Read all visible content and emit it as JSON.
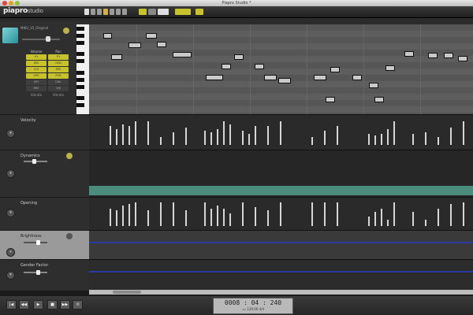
{
  "window": {
    "title": "Piapro Studio *"
  },
  "toolbar": {
    "brand": "piapro",
    "brand_suffix": "studio",
    "accent": "#c7c22c"
  },
  "track": {
    "name": "MIKU_V3_Original",
    "icon": "avatar-icon"
  },
  "vp_grid": {
    "headers": [
      "Volume",
      "Pan"
    ],
    "rows": [
      [
        {
          "label": "V1",
          "on": true
        },
        {
          "label": "P1",
          "on": true
        }
      ],
      [
        {
          "label": "BRI",
          "on": true
        },
        {
          "label": "GEN",
          "on": true
        }
      ],
      [
        {
          "label": "CLE",
          "on": true
        },
        {
          "label": "BRI",
          "on": true
        }
      ],
      [
        {
          "label": "OPE",
          "on": true
        },
        {
          "label": "POR",
          "on": true
        }
      ],
      [
        {
          "label": "XSY",
          "on": false
        },
        {
          "label": "GWL",
          "on": false
        }
      ],
      [
        {
          "label": "BRE",
          "on": false
        },
        {
          "label": "VIB",
          "on": false
        }
      ]
    ],
    "footer": [
      "Vibrato",
      "Vibrato"
    ]
  },
  "params": [
    {
      "label": "Velocity"
    },
    {
      "label": "Dynamics"
    },
    {
      "label": "Opening"
    },
    {
      "label": "Brightness"
    },
    {
      "label": "Gender Factor"
    }
  ],
  "transport": {
    "buttons": [
      "rewind-to-start",
      "rewind",
      "play",
      "stop",
      "fast-forward",
      "loop"
    ],
    "time": "0008 : 04 : 240",
    "tempo": "♩= 120.00   4/4"
  }
}
